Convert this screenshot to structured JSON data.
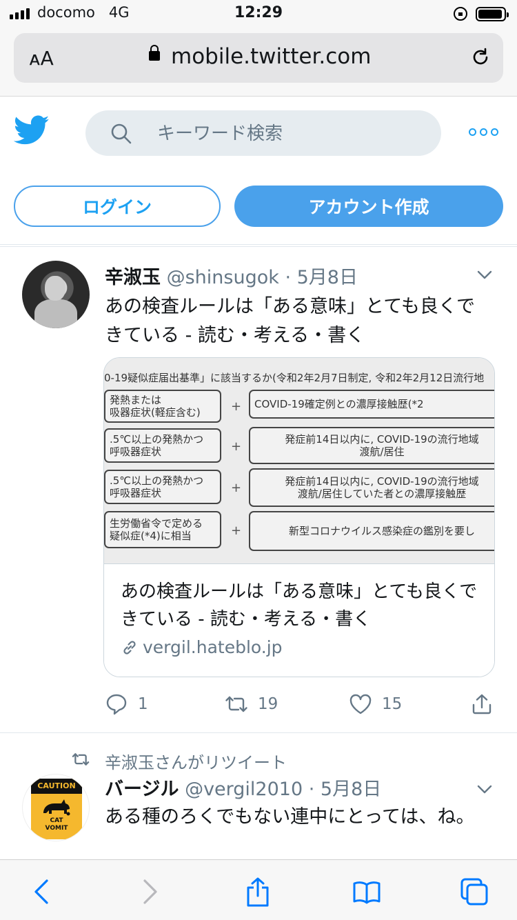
{
  "status_bar": {
    "carrier": "docomo",
    "network": "4G",
    "time": "12:29"
  },
  "safari": {
    "text_size_label": "ᴀA",
    "domain": "mobile.twitter.com"
  },
  "header": {
    "search_placeholder": "キーワード検索"
  },
  "auth": {
    "login_label": "ログイン",
    "signup_label": "アカウント作成"
  },
  "tweets": [
    {
      "name": "辛淑玉",
      "handle": "@shinsugok",
      "date": "5月8日",
      "text": "あの検査ルールは「ある意味」とても良くできている - 読む・考える・書く",
      "card": {
        "image_text": {
          "top": "0-19疑似症届出基準」に該当するか(令和2年2月7日制定, 令和2年2月12日流行地",
          "rows": [
            {
              "left": "発熱または\n吸器症状(軽症含む)",
              "right": "COVID-19確定例との濃厚接触歴(*2"
            },
            {
              "left": ".5℃以上の発熱かつ\n呼吸器症状",
              "right": "発症前14日以内に, COVID-19の流行地域\n渡航/居住"
            },
            {
              "left": ".5℃以上の発熱かつ\n呼吸器症状",
              "right": "発症前14日以内に, COVID-19の流行地域\n渡航/居住していた者との濃厚接触歴"
            },
            {
              "left": "生労働省令で定める\n疑似症(*4)に相当",
              "right": "新型コロナウイルス感染症の鑑別を要し"
            }
          ],
          "plus": "+"
        },
        "title": "あの検査ルールは「ある意味」とても良くできている - 読む・考える・書く",
        "link": "vergil.hateblo.jp"
      },
      "replies": "1",
      "retweets": "19",
      "likes": "15"
    },
    {
      "retweeted_by": "辛淑玉さんがリツイート",
      "name": "バージル",
      "handle": "@vergil2010",
      "date": "5月8日",
      "text": "ある種のろくでもない連中にとっては、ね。",
      "avatar_text": {
        "top": "CAUTION",
        "bottom": "CAT\nVOMIT"
      }
    }
  ],
  "colors": {
    "accent": "#1da1f2",
    "button_fill": "#4aa1eb",
    "muted": "#657786",
    "safari_blue": "#007aff"
  }
}
